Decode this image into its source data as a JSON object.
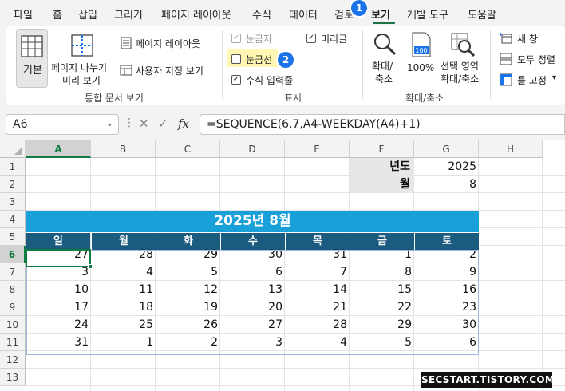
{
  "tabs": [
    {
      "label": "파일"
    },
    {
      "label": "홈"
    },
    {
      "label": "삽입"
    },
    {
      "label": "그리기"
    },
    {
      "label": "페이지 레이아웃"
    },
    {
      "label": "수식"
    },
    {
      "label": "데이터"
    },
    {
      "label": "검토"
    },
    {
      "label": "보기",
      "active": true
    },
    {
      "label": "개발 도구"
    },
    {
      "label": "도움말"
    }
  ],
  "step_badges": [
    "1",
    "2"
  ],
  "ribbon": {
    "workbook_views": {
      "normal": "기본",
      "page_break_line1": "페이지 나누기",
      "page_break_line2": "미리 보기",
      "page_layout": "페이지 레이아웃",
      "custom_views": "사용자 지정 보기",
      "group_label": "통합 문서 보기"
    },
    "show": {
      "ruler": {
        "label": "눈금자",
        "checked": true,
        "disabled": true
      },
      "gridlines": {
        "label": "눈금선",
        "checked": false
      },
      "formula_bar": {
        "label": "수식 입력줄",
        "checked": true
      },
      "headings": {
        "label": "머리글",
        "checked": true
      },
      "group_label": "표시"
    },
    "zoom": {
      "zoom_line1": "확대/",
      "zoom_line2": "축소",
      "zoom100": "100%",
      "zoom_selection_line1": "선택 영역",
      "zoom_selection_line2": "확대/축소",
      "group_label": "확대/축소"
    },
    "window": {
      "new_window": "새 창",
      "arrange_all": "모두 정렬",
      "freeze_panes": "틀 고정"
    }
  },
  "formula_bar": {
    "name_box": "A6",
    "fx": "fx",
    "formula": "=SEQUENCE(6,7,A4-WEEKDAY(A4)+1)"
  },
  "sheet": {
    "columns": [
      "A",
      "B",
      "C",
      "D",
      "E",
      "F",
      "G",
      "H"
    ],
    "rows": [
      "1",
      "2",
      "3",
      "4",
      "5",
      "6",
      "7",
      "8",
      "9",
      "10",
      "11",
      "12",
      "13"
    ],
    "year_label": "년도",
    "year_value": "2025",
    "month_label": "월",
    "month_value": "8",
    "calendar_title": "2025년 8월",
    "day_headers": [
      "일",
      "월",
      "화",
      "수",
      "목",
      "금",
      "토"
    ],
    "calendar": [
      [
        "27",
        "28",
        "29",
        "30",
        "31",
        "1",
        "2"
      ],
      [
        "3",
        "4",
        "5",
        "6",
        "7",
        "8",
        "9"
      ],
      [
        "10",
        "11",
        "12",
        "13",
        "14",
        "15",
        "16"
      ],
      [
        "17",
        "18",
        "19",
        "20",
        "21",
        "22",
        "23"
      ],
      [
        "24",
        "25",
        "26",
        "27",
        "28",
        "29",
        "30"
      ],
      [
        "31",
        "1",
        "2",
        "3",
        "4",
        "5",
        "6"
      ]
    ]
  },
  "watermark": "SECSTART.TISTORY.COM",
  "colors": {
    "accent": "#107c41",
    "title_band": "#1aa0d8",
    "day_header": "#1c5b80",
    "badge": "#1a73e8"
  }
}
